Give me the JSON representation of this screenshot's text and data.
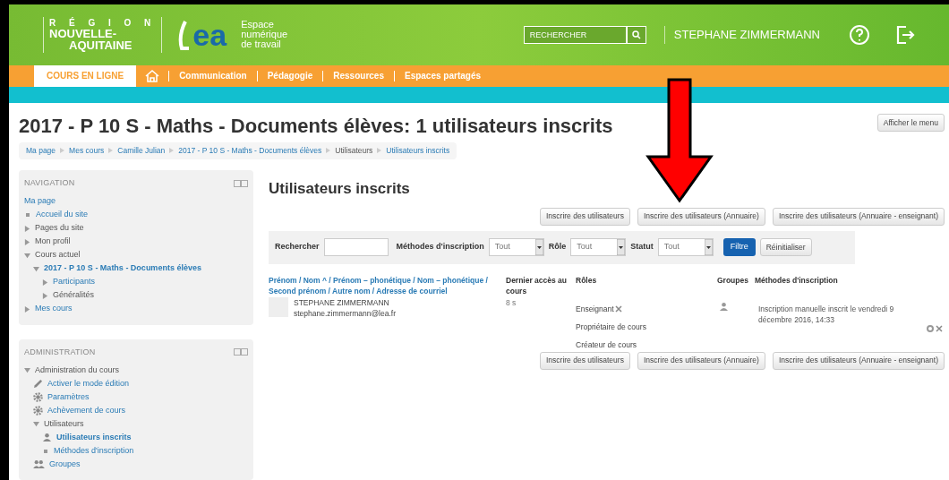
{
  "header": {
    "region_logo": {
      "line1": "R É G I O N",
      "line2": "NOUVELLE-",
      "line3": "AQUITAINE"
    },
    "lea_logo": "ea",
    "lea_tagline": [
      "Espace",
      "numérique",
      "de travail"
    ],
    "search": {
      "placeholder": "RECHERCHER"
    },
    "user": "STEPHANE ZIMMERMANN"
  },
  "nav_menu": [
    {
      "label": "COURS EN LIGNE",
      "kind": "tab",
      "selected": true
    },
    {
      "kind": "home",
      "selected": false
    },
    {
      "label": "Communication",
      "kind": "link",
      "selected": false
    },
    {
      "label": "Pédagogie",
      "kind": "link",
      "selected": false
    },
    {
      "label": "Ressources",
      "kind": "link",
      "selected": false
    },
    {
      "label": "Espaces partagés",
      "kind": "link",
      "selected": false
    }
  ],
  "page_title": "2017 - P 10 S - Maths - Documents élèves: 1 utilisateurs inscrits",
  "menu_button": "Afficher le menu",
  "breadcrumb": [
    {
      "label": "Ma page",
      "link": true
    },
    {
      "label": "Mes cours",
      "link": true
    },
    {
      "label": "Camille Julian",
      "link": true
    },
    {
      "label": "2017 - P 10 S - Maths - Documents élèves",
      "link": true
    },
    {
      "label": "Utilisateurs",
      "link": false
    },
    {
      "label": "Utilisateurs inscrits",
      "link": true
    }
  ],
  "navigation": {
    "title": "NAVIGATION",
    "items": [
      {
        "label": "Ma page",
        "kind": "plain",
        "link": true
      },
      {
        "label": "Accueil du site",
        "kind": "bullet",
        "link": true
      },
      {
        "label": "Pages du site",
        "kind": "collapsed",
        "link": false
      },
      {
        "label": "Mon profil",
        "kind": "collapsed",
        "link": false
      },
      {
        "label": "Cours actuel",
        "kind": "expanded",
        "link": false,
        "children": [
          {
            "label": "2017 - P 10 S - Maths - Documents élèves",
            "kind": "expanded",
            "link": true,
            "bold": true,
            "children": [
              {
                "label": "Participants",
                "kind": "collapsed",
                "link": true
              },
              {
                "label": "Généralités",
                "kind": "collapsed",
                "link": false
              }
            ]
          }
        ]
      },
      {
        "label": "Mes cours",
        "kind": "collapsed",
        "link": true
      }
    ]
  },
  "administration": {
    "title": "ADMINISTRATION",
    "items": [
      {
        "label": "Administration du cours",
        "kind": "expanded",
        "link": false,
        "children": [
          {
            "label": "Activer le mode édition",
            "kind": "pencil",
            "link": true
          },
          {
            "label": "Paramètres",
            "kind": "gear",
            "link": true
          },
          {
            "label": "Achèvement de cours",
            "kind": "gear",
            "link": true
          },
          {
            "label": "Utilisateurs",
            "kind": "expanded",
            "link": false,
            "children": [
              {
                "label": "Utilisateurs inscrits",
                "kind": "user",
                "link": true,
                "bold": true
              },
              {
                "label": "Méthodes d'inscription",
                "kind": "bullet",
                "link": true
              }
            ]
          },
          {
            "label": "Groupes",
            "kind": "users",
            "link": true
          }
        ]
      }
    ]
  },
  "section_title": "Utilisateurs inscrits",
  "enrol_buttons_top": [
    "Inscrire des utilisateurs",
    "Inscrire des utilisateurs (Annuaire)",
    "Inscrire des utilisateurs (Annuaire - enseignant)"
  ],
  "filter": {
    "search_label": "Rechercher",
    "fields": [
      {
        "label": "Méthodes d'inscription",
        "value": "Tout"
      },
      {
        "label": "Rôle",
        "value": "Tout"
      },
      {
        "label": "Statut",
        "value": "Tout"
      }
    ],
    "filter_button": "Filtre",
    "reset_button": "Réinitialiser"
  },
  "table": {
    "columns": [
      "Prénom / Nom ^ / Prénom – phonétique / Nom – phonétique / Second prénom / Autre nom / Adresse de courriel",
      "Dernier accès au cours",
      "Rôles",
      "Groupes",
      "Méthodes d'inscription"
    ],
    "rows": [
      {
        "name": "STEPHANE ZIMMERMANN",
        "email": "stephane.zimmermann@lea.fr",
        "last_access": "8 s",
        "roles": [
          {
            "label": "Enseignant",
            "removable": true
          },
          {
            "label": "Propriétaire de cours",
            "removable": false
          },
          {
            "label": "Créateur de cours",
            "removable": false
          }
        ],
        "enrolment": "Inscription manuelle inscrit le vendredi 9 décembre 2016, 14:33"
      }
    ]
  },
  "enrol_buttons_bottom": [
    "Inscrire des utilisateurs",
    "Inscrire des utilisateurs (Annuaire)",
    "Inscrire des utilisateurs (Annuaire - enseignant)"
  ]
}
